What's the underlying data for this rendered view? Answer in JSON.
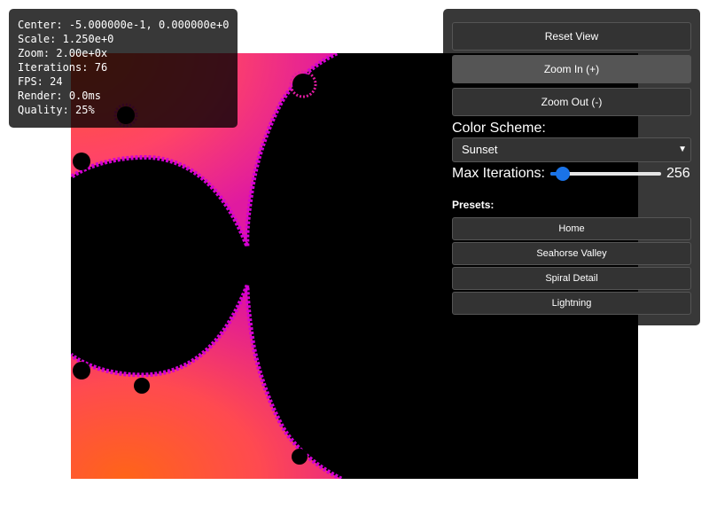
{
  "info": {
    "center_label": "Center:",
    "center_value": "-5.000000e-1, 0.000000e+0",
    "scale_label": "Scale:",
    "scale_value": "1.250e+0",
    "zoom_label": "Zoom:",
    "zoom_value": "2.00e+0x",
    "iterations_label": "Iterations:",
    "iterations_value": "76",
    "fps_label": "FPS:",
    "fps_value": "24",
    "render_label": "Render:",
    "render_value": "0.0ms",
    "quality_label": "Quality:",
    "quality_value": "25%"
  },
  "controls": {
    "reset_label": "Reset View",
    "zoom_in_label": "Zoom In (+)",
    "zoom_out_label": "Zoom Out (-)",
    "color_scheme_label": "Color Scheme:",
    "color_scheme_value": "Sunset",
    "max_iterations_label": "Max Iterations:",
    "max_iterations_value": "256",
    "slider_fraction": 0.06
  },
  "presets": {
    "title": "Presets:",
    "items": [
      "Home",
      "Seahorse Valley",
      "Spiral Detail",
      "Lightning"
    ]
  },
  "colors": {
    "fractal_inside": "#000000",
    "sunset_outer": "#ff6a1a",
    "sunset_mid": "#ff3d7f",
    "sunset_edge": "#d400d4",
    "panel_bg": "#1f1f1f",
    "accent": "#1a73e8"
  }
}
